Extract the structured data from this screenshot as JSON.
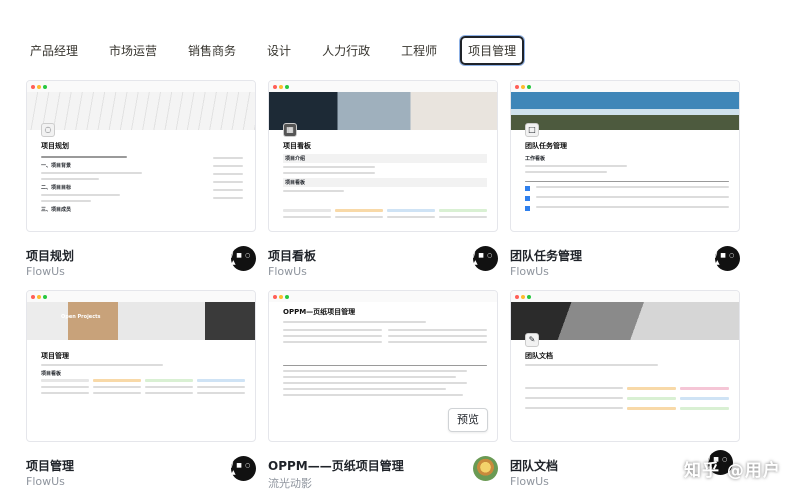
{
  "tabs": [
    {
      "label": "产品经理",
      "active": false
    },
    {
      "label": "市场运营",
      "active": false
    },
    {
      "label": "销售商务",
      "active": false
    },
    {
      "label": "设计",
      "active": false
    },
    {
      "label": "人力行政",
      "active": false
    },
    {
      "label": "工程师",
      "active": false
    },
    {
      "label": "项目管理",
      "active": true
    }
  ],
  "cards": [
    {
      "title": "项目规划",
      "author": "FlowUs",
      "logo": "/ ■ ○ ▲",
      "preview": {
        "title": "项目规划",
        "sections": [
          "一、项目背景",
          "二、项目目标",
          "三、项目成员"
        ]
      }
    },
    {
      "title": "项目看板",
      "author": "FlowUs",
      "logo": "/ ■ ○ ▲",
      "preview": {
        "title": "项目看板",
        "sections": [
          "项目介绍",
          "项目看板"
        ]
      }
    },
    {
      "title": "团队任务管理",
      "author": "FlowUs",
      "logo": "/ ■ ○ ▲",
      "preview": {
        "title": "团队任务管理",
        "sections": [
          "工作看板"
        ]
      }
    },
    {
      "title": "项目管理",
      "author": "FlowUs",
      "logo": "/ ■ ○ ▲",
      "preview": {
        "title": "项目管理",
        "sections": [
          "项目看板"
        ],
        "cover_text": "Open Projects"
      }
    },
    {
      "title": "OPPM——页纸项目管理",
      "author": "流光动影",
      "logo": "",
      "preview": {
        "title": "OPPM—页纸项目管理",
        "sections": []
      },
      "preview_button": "预览"
    },
    {
      "title": "团队文档",
      "author": "FlowUs",
      "logo": "/ ■ ○ ▲",
      "preview": {
        "title": "团队文档",
        "sections": []
      }
    }
  ],
  "watermark": "知乎 @用户"
}
